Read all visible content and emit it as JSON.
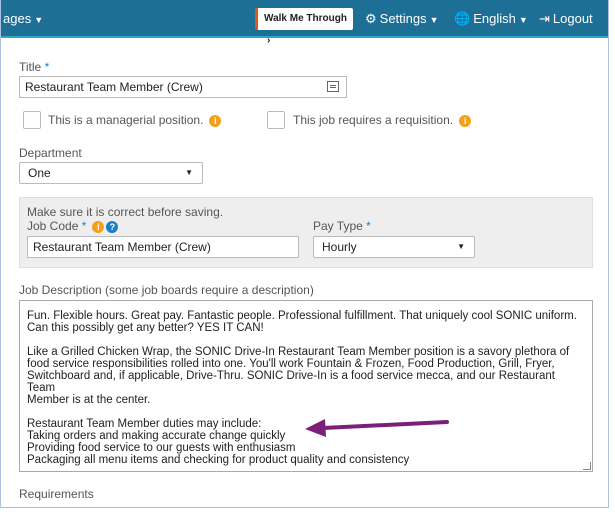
{
  "nav": {
    "pages_label": "ages",
    "walk_me_through": "Walk Me Through",
    "settings": "Settings",
    "language": "English",
    "logout": "Logout"
  },
  "form": {
    "title_label": "Title",
    "title_value": "Restaurant Team Member (Crew)",
    "managerial_label": "This is a managerial position.",
    "requisition_label": "This job requires a requisition.",
    "department_label": "Department",
    "department_value": "One",
    "panel_note": "Make sure it is correct before saving.",
    "job_code_label": "Job Code",
    "job_code_value": "Restaurant Team Member (Crew)",
    "pay_type_label": "Pay Type",
    "pay_type_value": "Hourly",
    "description_label": "Job Description (some job boards require a description)",
    "description_p1": "Fun. Flexible hours. Great pay. Fantastic people. Professional fulfillment. That uniquely cool SONIC uniform.\nCan this possibly get any better? YES IT CAN!",
    "description_p2": "Like a Grilled Chicken Wrap, the SONIC Drive-In Restaurant Team Member position is a savory plethora of\nfood service responsibilities rolled into one. You'll work Fountain & Frozen, Food Production, Grill, Fryer,\nSwitchboard and, if applicable, Drive-Thru. SONIC Drive-In is a food service mecca, and our Restaurant Team\nMember is at the center.",
    "description_p3": "Restaurant Team Member duties may include:\nTaking orders and making accurate change quickly\nProviding food service to our guests with enthusiasm\nPackaging all menu items and checking for product quality and consistency",
    "requirements_label": "Requirements"
  },
  "colors": {
    "nav_bg": "#1d6f96",
    "accent_blue": "#1a7fc4",
    "info_orange": "#f2a11b",
    "arrow_purple": "#7b1f7a"
  }
}
